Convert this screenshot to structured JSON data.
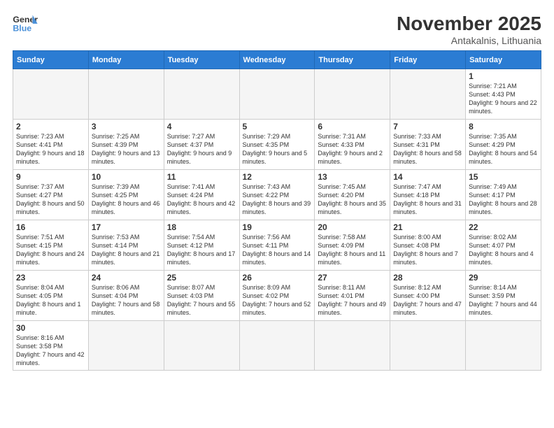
{
  "logo": {
    "general": "General",
    "blue": "Blue"
  },
  "header": {
    "month": "November 2025",
    "location": "Antakalnis, Lithuania"
  },
  "weekdays": [
    "Sunday",
    "Monday",
    "Tuesday",
    "Wednesday",
    "Thursday",
    "Friday",
    "Saturday"
  ],
  "weeks": [
    [
      {
        "day": "",
        "info": ""
      },
      {
        "day": "",
        "info": ""
      },
      {
        "day": "",
        "info": ""
      },
      {
        "day": "",
        "info": ""
      },
      {
        "day": "",
        "info": ""
      },
      {
        "day": "",
        "info": ""
      },
      {
        "day": "1",
        "info": "Sunrise: 7:21 AM\nSunset: 4:43 PM\nDaylight: 9 hours\nand 22 minutes."
      }
    ],
    [
      {
        "day": "2",
        "info": "Sunrise: 7:23 AM\nSunset: 4:41 PM\nDaylight: 9 hours\nand 18 minutes."
      },
      {
        "day": "3",
        "info": "Sunrise: 7:25 AM\nSunset: 4:39 PM\nDaylight: 9 hours\nand 13 minutes."
      },
      {
        "day": "4",
        "info": "Sunrise: 7:27 AM\nSunset: 4:37 PM\nDaylight: 9 hours\nand 9 minutes."
      },
      {
        "day": "5",
        "info": "Sunrise: 7:29 AM\nSunset: 4:35 PM\nDaylight: 9 hours\nand 5 minutes."
      },
      {
        "day": "6",
        "info": "Sunrise: 7:31 AM\nSunset: 4:33 PM\nDaylight: 9 hours\nand 2 minutes."
      },
      {
        "day": "7",
        "info": "Sunrise: 7:33 AM\nSunset: 4:31 PM\nDaylight: 8 hours\nand 58 minutes."
      },
      {
        "day": "8",
        "info": "Sunrise: 7:35 AM\nSunset: 4:29 PM\nDaylight: 8 hours\nand 54 minutes."
      }
    ],
    [
      {
        "day": "9",
        "info": "Sunrise: 7:37 AM\nSunset: 4:27 PM\nDaylight: 8 hours\nand 50 minutes."
      },
      {
        "day": "10",
        "info": "Sunrise: 7:39 AM\nSunset: 4:25 PM\nDaylight: 8 hours\nand 46 minutes."
      },
      {
        "day": "11",
        "info": "Sunrise: 7:41 AM\nSunset: 4:24 PM\nDaylight: 8 hours\nand 42 minutes."
      },
      {
        "day": "12",
        "info": "Sunrise: 7:43 AM\nSunset: 4:22 PM\nDaylight: 8 hours\nand 39 minutes."
      },
      {
        "day": "13",
        "info": "Sunrise: 7:45 AM\nSunset: 4:20 PM\nDaylight: 8 hours\nand 35 minutes."
      },
      {
        "day": "14",
        "info": "Sunrise: 7:47 AM\nSunset: 4:18 PM\nDaylight: 8 hours\nand 31 minutes."
      },
      {
        "day": "15",
        "info": "Sunrise: 7:49 AM\nSunset: 4:17 PM\nDaylight: 8 hours\nand 28 minutes."
      }
    ],
    [
      {
        "day": "16",
        "info": "Sunrise: 7:51 AM\nSunset: 4:15 PM\nDaylight: 8 hours\nand 24 minutes."
      },
      {
        "day": "17",
        "info": "Sunrise: 7:53 AM\nSunset: 4:14 PM\nDaylight: 8 hours\nand 21 minutes."
      },
      {
        "day": "18",
        "info": "Sunrise: 7:54 AM\nSunset: 4:12 PM\nDaylight: 8 hours\nand 17 minutes."
      },
      {
        "day": "19",
        "info": "Sunrise: 7:56 AM\nSunset: 4:11 PM\nDaylight: 8 hours\nand 14 minutes."
      },
      {
        "day": "20",
        "info": "Sunrise: 7:58 AM\nSunset: 4:09 PM\nDaylight: 8 hours\nand 11 minutes."
      },
      {
        "day": "21",
        "info": "Sunrise: 8:00 AM\nSunset: 4:08 PM\nDaylight: 8 hours\nand 7 minutes."
      },
      {
        "day": "22",
        "info": "Sunrise: 8:02 AM\nSunset: 4:07 PM\nDaylight: 8 hours\nand 4 minutes."
      }
    ],
    [
      {
        "day": "23",
        "info": "Sunrise: 8:04 AM\nSunset: 4:05 PM\nDaylight: 8 hours\nand 1 minute."
      },
      {
        "day": "24",
        "info": "Sunrise: 8:06 AM\nSunset: 4:04 PM\nDaylight: 7 hours\nand 58 minutes."
      },
      {
        "day": "25",
        "info": "Sunrise: 8:07 AM\nSunset: 4:03 PM\nDaylight: 7 hours\nand 55 minutes."
      },
      {
        "day": "26",
        "info": "Sunrise: 8:09 AM\nSunset: 4:02 PM\nDaylight: 7 hours\nand 52 minutes."
      },
      {
        "day": "27",
        "info": "Sunrise: 8:11 AM\nSunset: 4:01 PM\nDaylight: 7 hours\nand 49 minutes."
      },
      {
        "day": "28",
        "info": "Sunrise: 8:12 AM\nSunset: 4:00 PM\nDaylight: 7 hours\nand 47 minutes."
      },
      {
        "day": "29",
        "info": "Sunrise: 8:14 AM\nSunset: 3:59 PM\nDaylight: 7 hours\nand 44 minutes."
      }
    ],
    [
      {
        "day": "30",
        "info": "Sunrise: 8:16 AM\nSunset: 3:58 PM\nDaylight: 7 hours\nand 42 minutes."
      },
      {
        "day": "",
        "info": ""
      },
      {
        "day": "",
        "info": ""
      },
      {
        "day": "",
        "info": ""
      },
      {
        "day": "",
        "info": ""
      },
      {
        "day": "",
        "info": ""
      },
      {
        "day": "",
        "info": ""
      }
    ]
  ]
}
